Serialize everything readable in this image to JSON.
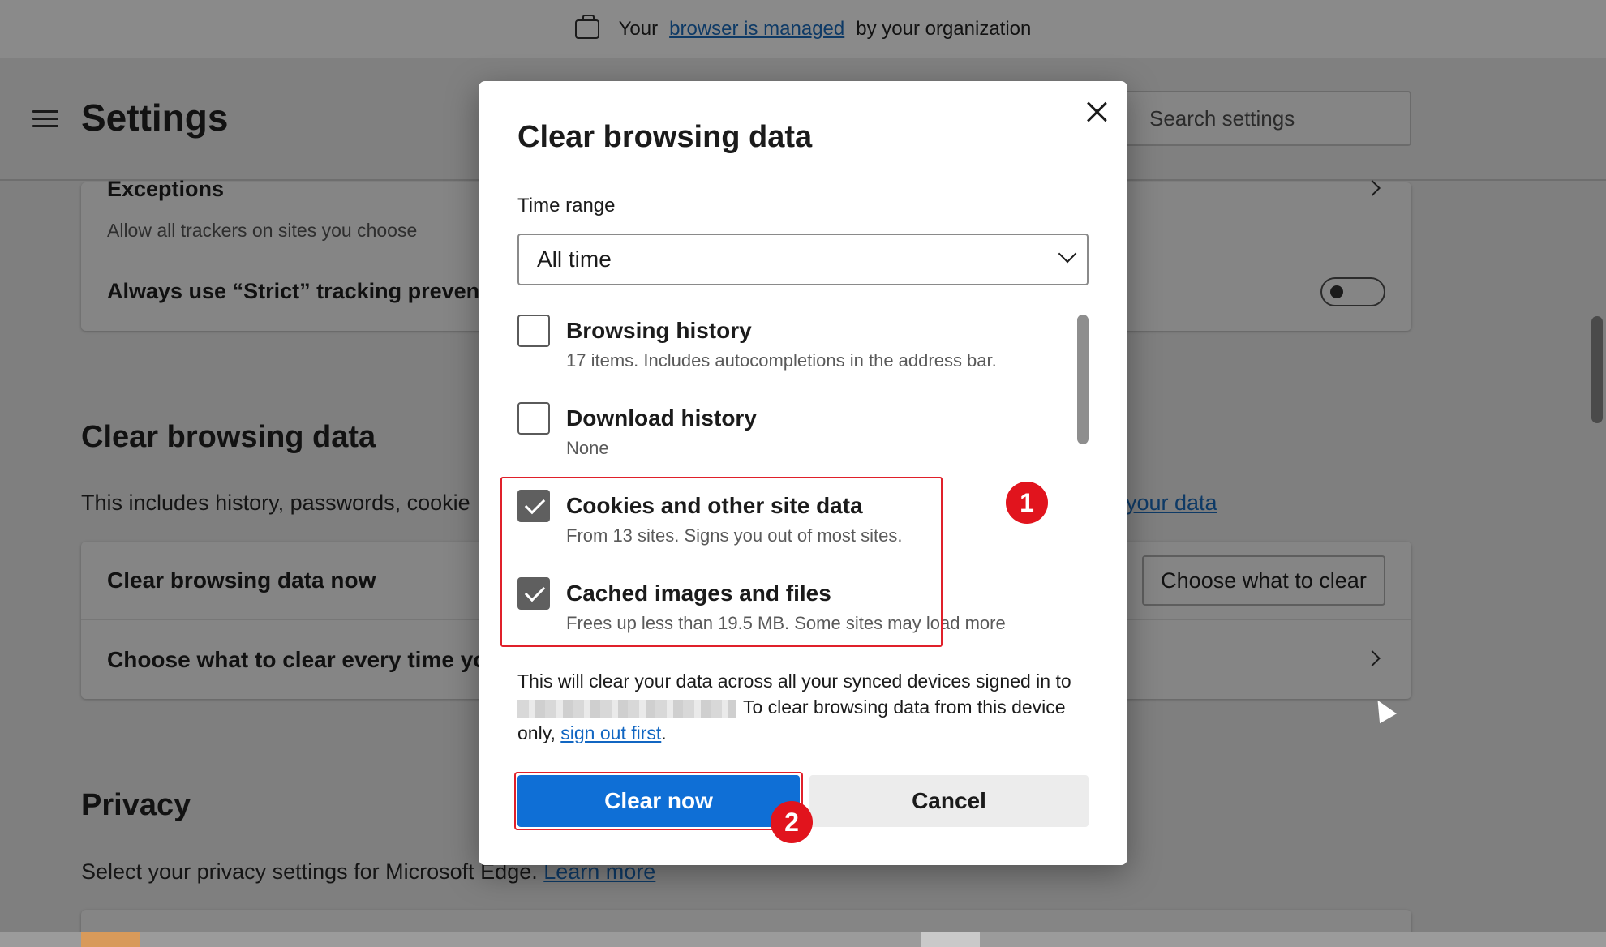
{
  "managed_bar": {
    "prefix": "Your",
    "link": "browser is managed",
    "suffix": "by your organization"
  },
  "header": {
    "title": "Settings",
    "search_placeholder": "Search settings"
  },
  "tracking_card": {
    "exceptions_title": "Exceptions",
    "exceptions_sub": "Allow all trackers on sites you choose",
    "strict_label": "Always use “Strict” tracking preventi"
  },
  "clear_section": {
    "title": "Clear browsing data",
    "description": "This includes history, passwords, cookie",
    "manage_link": "your data",
    "row1_label": "Clear browsing data now",
    "row1_button": "Choose what to clear",
    "row2_label": "Choose what to clear every time you"
  },
  "privacy_section": {
    "title": "Privacy",
    "description": "Select your privacy settings for Microsoft Edge.",
    "learn_more": "Learn more"
  },
  "dialog": {
    "title": "Clear browsing data",
    "time_range_label": "Time range",
    "time_range_value": "All time",
    "items": [
      {
        "title": "Browsing history",
        "sub": "17 items. Includes autocompletions in the address bar.",
        "checked": false
      },
      {
        "title": "Download history",
        "sub": "None",
        "checked": false
      },
      {
        "title": "Cookies and other site data",
        "sub": "From 13 sites. Signs you out of most sites.",
        "checked": true
      },
      {
        "title": "Cached images and files",
        "sub": "Frees up less than 19.5 MB. Some sites may load more",
        "checked": true
      }
    ],
    "sync_text_1": "This will clear your data across all your synced devices signed in to",
    "sync_text_2": "To clear browsing data from this device only,",
    "sync_link": "sign out first",
    "sync_period": ".",
    "clear_button": "Clear now",
    "cancel_button": "Cancel"
  },
  "annotations": {
    "badge1": "1",
    "badge2": "2",
    "highlight_color": "#e0202a"
  },
  "colors": {
    "primary_button": "#0f6fd6",
    "link": "#1166c2"
  }
}
